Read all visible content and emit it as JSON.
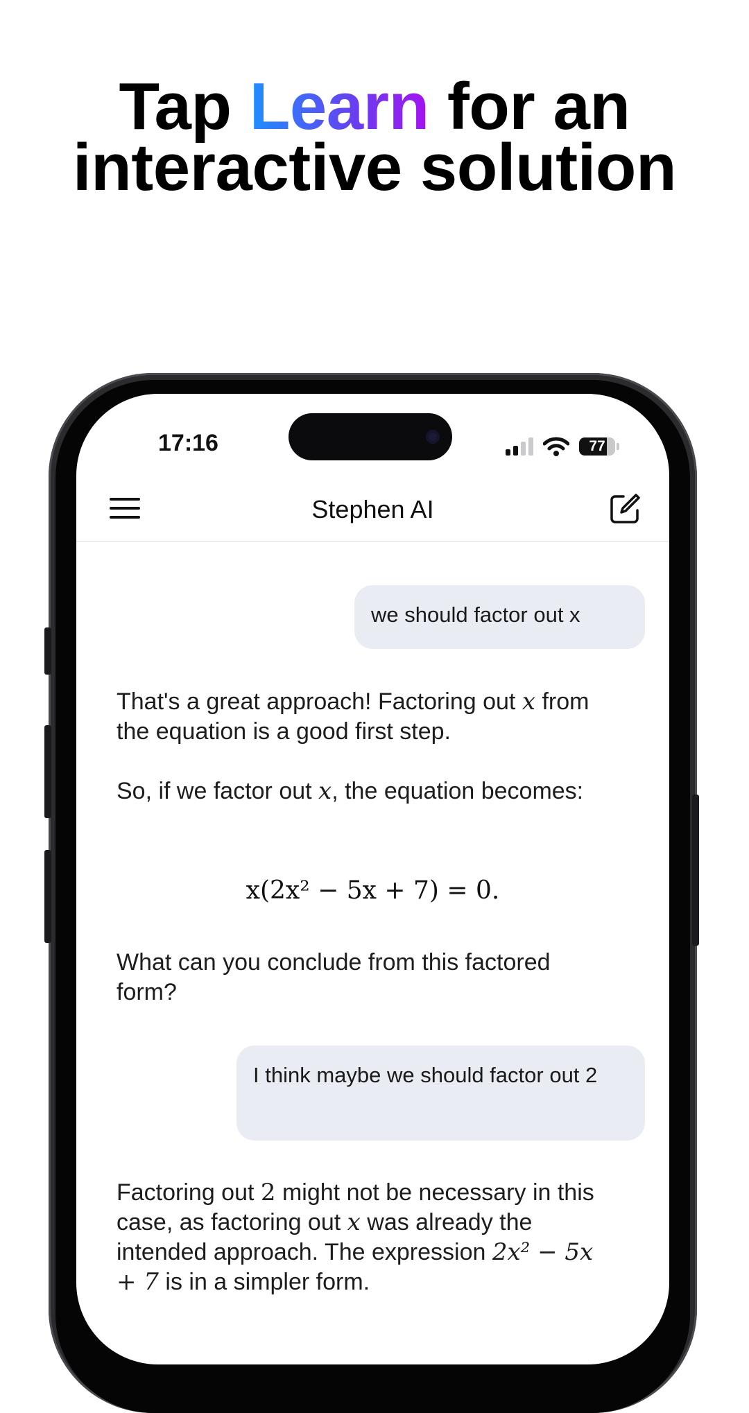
{
  "headline": {
    "pre": "Tap ",
    "highlight": "Learn",
    "post": " for an",
    "line2": "interactive solution"
  },
  "colors": {
    "gradient_start": "#1e90ff",
    "gradient_end": "#a512f0",
    "user_bubble": "#e9edf3"
  },
  "status_bar": {
    "time": "17:16",
    "battery": "77",
    "icons": [
      "signal-icon",
      "wifi-icon",
      "battery-icon"
    ]
  },
  "app_bar": {
    "title": "Stephen AI",
    "menu_icon": "menu-icon",
    "compose_icon": "compose-icon"
  },
  "chat": {
    "user_1": "we should factor out x",
    "ai_1_p1": {
      "a": "That's a great approach! Factoring out ",
      "var": "x",
      "b": " from the equation is a good first step."
    },
    "ai_1_p2": {
      "a": "So, if we factor out ",
      "var": "x",
      "b": ", the equation becomes:"
    },
    "ai_1_equation": "x(2x² − 5x + 7) = 0.",
    "ai_1_p3": "What can you conclude from this factored form?",
    "user_2": "I think maybe we should factor out 2",
    "ai_2": {
      "a": "Factoring out ",
      "var1": "2",
      "b": " might not be necessary in this case, as factoring out ",
      "var2": "x",
      "c": " was already the intended approach. The expression ",
      "expr": "2x² − 5x + 7",
      "d": " is in a simpler form."
    }
  }
}
